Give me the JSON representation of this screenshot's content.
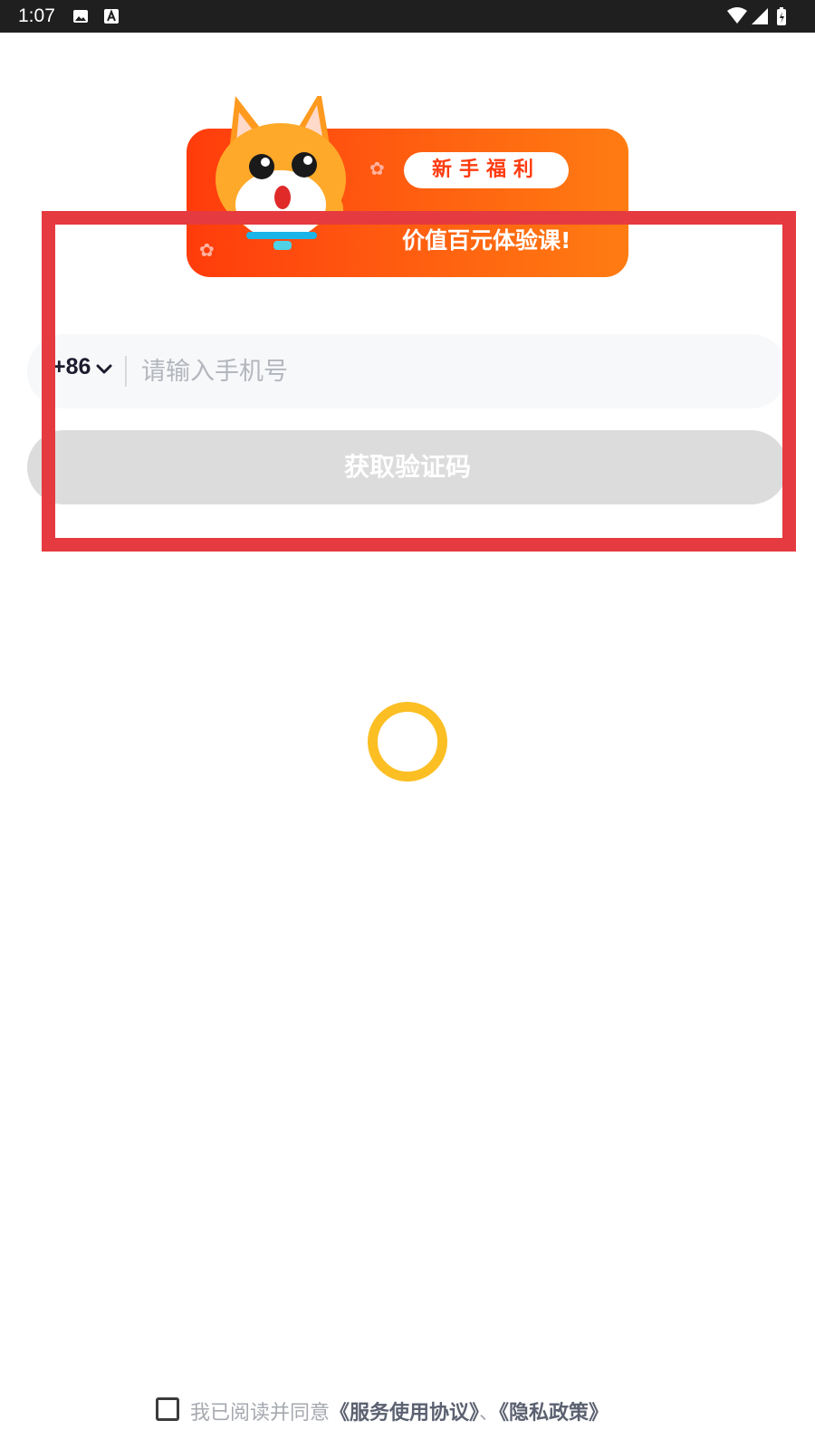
{
  "status_bar": {
    "time": "1:07",
    "icons": [
      "image-icon",
      "a-notification-icon",
      "wifi-icon",
      "signal-icon",
      "battery-icon"
    ]
  },
  "banner": {
    "tag": "新手福利",
    "main_text": "价值百元体验课!",
    "colors": {
      "start": "#ff3c0c",
      "end": "#ff7c12"
    }
  },
  "login": {
    "country_code": "+86",
    "phone_placeholder": "请输入手机号",
    "get_code_label": "获取验证码"
  },
  "agreement": {
    "prefix": "我已阅读并同意",
    "service_link": "《服务使用协议》",
    "separator": "、",
    "privacy_link": "《隐私政策》"
  },
  "colors": {
    "highlight": "#e53a3f",
    "spinner": "#fbbf24",
    "button_disabled": "#dcdcdc"
  }
}
